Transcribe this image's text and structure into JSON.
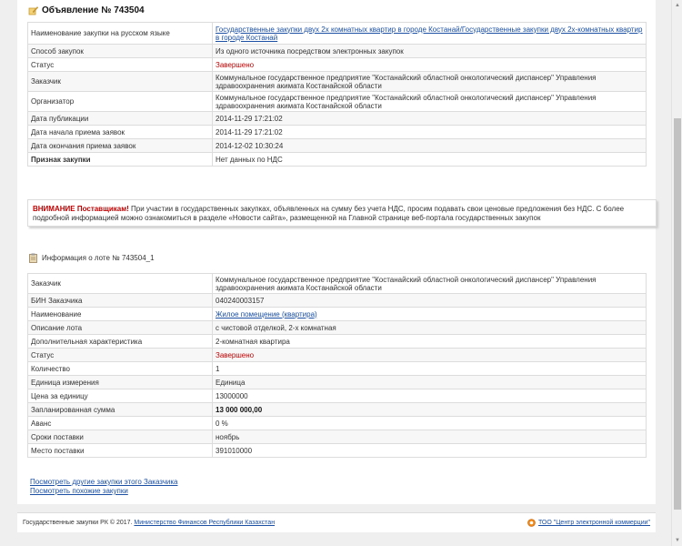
{
  "announcement": {
    "title": "Объявление № 743504",
    "rows": [
      {
        "label": "Наименование закупки на русском языке",
        "value": "Государственные закупки двух 2х комнатных квартир в городе Костанай/Государственные закупки двух 2х-комнатных квартир в городе Костанай",
        "kind": "link"
      },
      {
        "label": "Способ закупок",
        "value": "Из одного источника посредством электронных закупок",
        "kind": "text"
      },
      {
        "label": "Статус",
        "value": "Завершено",
        "kind": "red"
      },
      {
        "label": "Заказчик",
        "value": "Коммунальное государственное предприятие \"Костанайский областной онкологический диспансер\" Управления здравоохранения акимата Костанайской области",
        "kind": "text"
      },
      {
        "label": "Организатор",
        "value": "Коммунальное государственное предприятие \"Костанайский областной онкологический диспансер\" Управления здравоохранения акимата Костанайской области",
        "kind": "text"
      },
      {
        "label": "Дата публикации",
        "value": "2014-11-29 17:21:02",
        "kind": "text"
      },
      {
        "label": "Дата начала приема заявок",
        "value": "2014-11-29 17:21:02",
        "kind": "text"
      },
      {
        "label": "Дата окончания приема заявок",
        "value": "2014-12-02 10:30:24",
        "kind": "text"
      },
      {
        "label": "Признак закупки",
        "value": "Нет данных по НДС",
        "kind": "text",
        "bold_label": true
      }
    ]
  },
  "warning": {
    "highlight": "ВНИМАНИЕ Поставщикам!",
    "text": " При участии в государственных закупках, объявленных на сумму без учета НДС, просим подавать свои ценовые предложения без НДС. С более подробной информацией можно ознакомиться в разделе «Новости сайта», размещенной на Главной странице веб-портала государственных закупок"
  },
  "lot": {
    "header": "Информация о лоте № 743504_1",
    "rows": [
      {
        "label": "Заказчик",
        "value": "Коммунальное государственное предприятие \"Костанайский областной онкологический диспансер\" Управления здравоохранения акимата Костанайской области",
        "kind": "text"
      },
      {
        "label": "БИН Заказчика",
        "value": "040240003157",
        "kind": "text"
      },
      {
        "label": "Наименование",
        "value": "Жилое помещение (квартира)",
        "kind": "link"
      },
      {
        "label": "Описание лота",
        "value": "с чистовой отделкой, 2-х комнатная",
        "kind": "text"
      },
      {
        "label": "Дополнительная характеристика",
        "value": "2-комнатная квартира",
        "kind": "text"
      },
      {
        "label": "Статус",
        "value": "Завершено",
        "kind": "red"
      },
      {
        "label": "Количество",
        "value": "1",
        "kind": "text"
      },
      {
        "label": "Единица измерения",
        "value": "Единица",
        "kind": "text"
      },
      {
        "label": "Цена за единицу",
        "value": "13000000",
        "kind": "text"
      },
      {
        "label": "Запланированная сумма",
        "value": "13 000 000,00",
        "kind": "bold"
      },
      {
        "label": "Аванс",
        "value": "0 %",
        "kind": "text"
      },
      {
        "label": "Сроки поставки",
        "value": "ноябрь",
        "kind": "text"
      },
      {
        "label": "Место поставки",
        "value": "391010000",
        "kind": "text"
      }
    ]
  },
  "links": {
    "other_purchases": "Посмотреть другие закупки этого Заказчика",
    "similar_purchases": "Посмотреть похожие закупки"
  },
  "footer": {
    "copyright": "Государственные закупки РК © 2017.",
    "ministry_link": "Министерство Финансов Республики Казахстан",
    "center_link": "ТОО \"Центр электронной коммерции\""
  }
}
